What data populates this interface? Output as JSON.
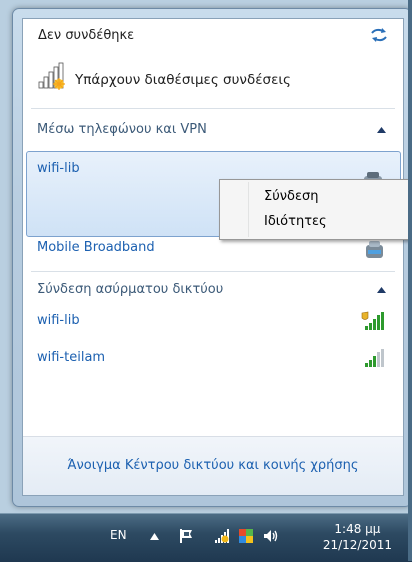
{
  "popup": {
    "status": "Δεν συνδέθηκε",
    "available": "Υπάρχουν διαθέσιμες συνδέσεις",
    "sections": [
      {
        "title": "Μέσω τηλεφώνου και VPN"
      },
      {
        "title": "Σύνδεση ασύρματου δικτύου"
      }
    ],
    "dialup_items": [
      {
        "name": "wifi-lib"
      },
      {
        "name": "Mobile Broadband"
      }
    ],
    "wireless_items": [
      {
        "name": "wifi-lib",
        "secured": true
      },
      {
        "name": "wifi-teilam",
        "secured": false
      }
    ],
    "footer_link": "Άνοιγμα Κέντρου δικτύου και κοινής χρήσης"
  },
  "context_menu": {
    "items": [
      {
        "label": "Σύνδεση"
      },
      {
        "label": "Ιδιότητες"
      }
    ]
  },
  "taskbar": {
    "language": "EN",
    "time": "1:48 μμ",
    "date": "21/12/2011",
    "tray_icons": [
      "action-center-flag-icon",
      "network-icon",
      "colorful-app-icon",
      "volume-icon"
    ]
  },
  "colors": {
    "link": "#1c60b0",
    "section": "#3c5a78",
    "selection": "#cfe2f6"
  }
}
